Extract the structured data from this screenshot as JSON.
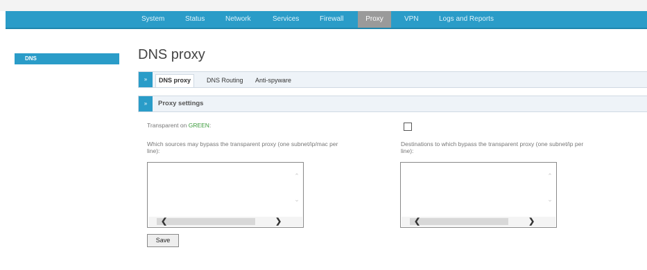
{
  "nav": {
    "items": [
      {
        "label": "System"
      },
      {
        "label": "Status"
      },
      {
        "label": "Network"
      },
      {
        "label": "Services"
      },
      {
        "label": "Firewall"
      },
      {
        "label": "Proxy",
        "active": true
      },
      {
        "label": "VPN"
      },
      {
        "label": "Logs and Reports"
      }
    ]
  },
  "sidebar": {
    "items": [
      {
        "label": "DNS",
        "active": true
      }
    ]
  },
  "page": {
    "title": "DNS proxy"
  },
  "tabs": {
    "arrow": "»",
    "items": [
      {
        "label": "DNS proxy",
        "active": true
      },
      {
        "label": "DNS Routing"
      },
      {
        "label": "Anti-spyware"
      }
    ]
  },
  "section": {
    "arrow": "»",
    "title": "Proxy settings"
  },
  "form": {
    "transparent_label_prefix": "Transparent on ",
    "transparent_label_zone": "GREEN",
    "transparent_label_suffix": ":",
    "transparent_checked": false,
    "sources_label_line1": "Which sources may bypass the transparent proxy (one subnet/ip/mac per",
    "sources_label_line2": "line):",
    "sources_value": "",
    "destinations_label_line1": "Destinations to which bypass the transparent proxy (one subnet/ip per",
    "destinations_label_line2": "line):",
    "destinations_value": "",
    "save_label": "Save"
  },
  "colors": {
    "nav_bar": "#2a9cc8",
    "nav_active": "#9a9a9a",
    "zone_green": "#3a9a3a"
  },
  "icons": {
    "scroll_up": "chevron-up-icon",
    "scroll_down": "chevron-down-icon",
    "scroll_left": "chevron-left-icon",
    "scroll_right": "chevron-right-icon"
  }
}
